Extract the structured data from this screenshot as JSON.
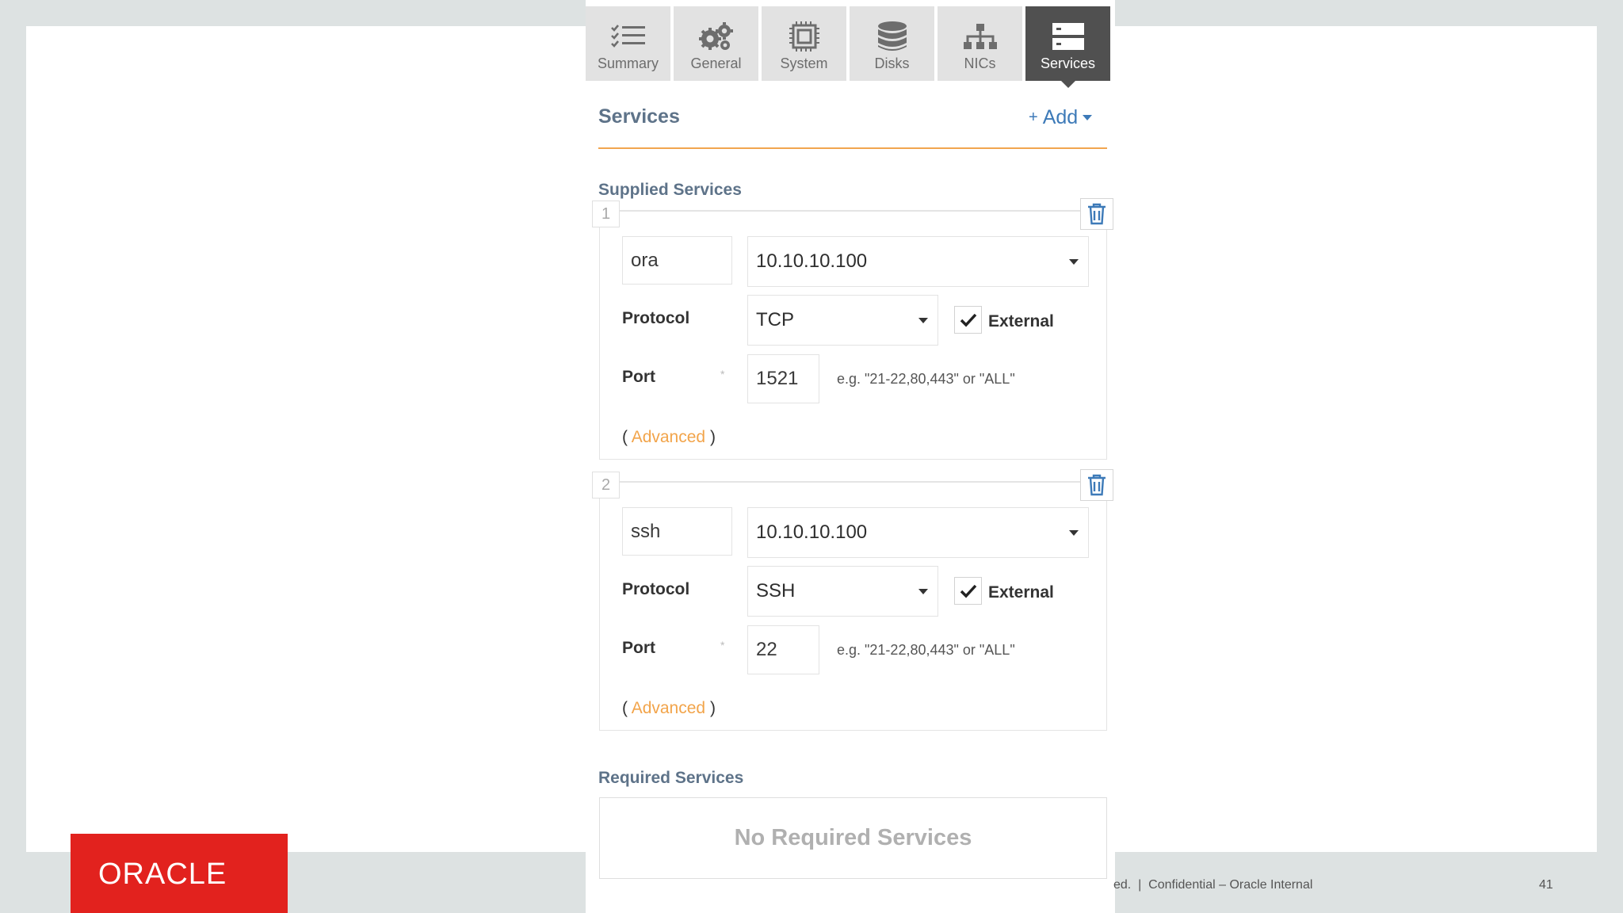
{
  "tabs": [
    {
      "label": "Summary",
      "icon": "list-check-icon",
      "active": false
    },
    {
      "label": "General",
      "icon": "gears-icon",
      "active": false
    },
    {
      "label": "System",
      "icon": "chip-icon",
      "active": false
    },
    {
      "label": "Disks",
      "icon": "database-icon",
      "active": false
    },
    {
      "label": "NICs",
      "icon": "network-icon",
      "active": false
    },
    {
      "label": "Services",
      "icon": "server-icon",
      "active": true
    }
  ],
  "header": {
    "title": "Services",
    "add_plus": "+",
    "add_label": "Add"
  },
  "supplied": {
    "title": "Supplied Services",
    "services": [
      {
        "index": "1",
        "name": "ora",
        "address": "10.10.10.100",
        "protocol_label": "Protocol",
        "protocol": "TCP",
        "external_label": "External",
        "external": true,
        "port_label": "Port",
        "port": "1521",
        "port_hint": "e.g. \"21-22,80,443\" or \"ALL\"",
        "adv_open": "(",
        "adv_label": "Advanced",
        "adv_close": ")"
      },
      {
        "index": "2",
        "name": "ssh",
        "address": "10.10.10.100",
        "protocol_label": "Protocol",
        "protocol": "SSH",
        "external_label": "External",
        "external": true,
        "port_label": "Port",
        "port": "22",
        "port_hint": "e.g. \"21-22,80,443\" or \"ALL\"",
        "adv_open": "(",
        "adv_label": "Advanced",
        "adv_close": ")"
      }
    ]
  },
  "required": {
    "title": "Required Services",
    "empty_text": "No Required Services"
  },
  "footer": {
    "logo_text": "ORACLE",
    "text": "ed.  |  Confidential – Oracle Internal",
    "page": "41"
  },
  "colors": {
    "brand_red": "#e2221e",
    "accent_orange": "#f1a64f",
    "link_blue": "#3d7ab8",
    "title_slate": "#5e7389"
  }
}
